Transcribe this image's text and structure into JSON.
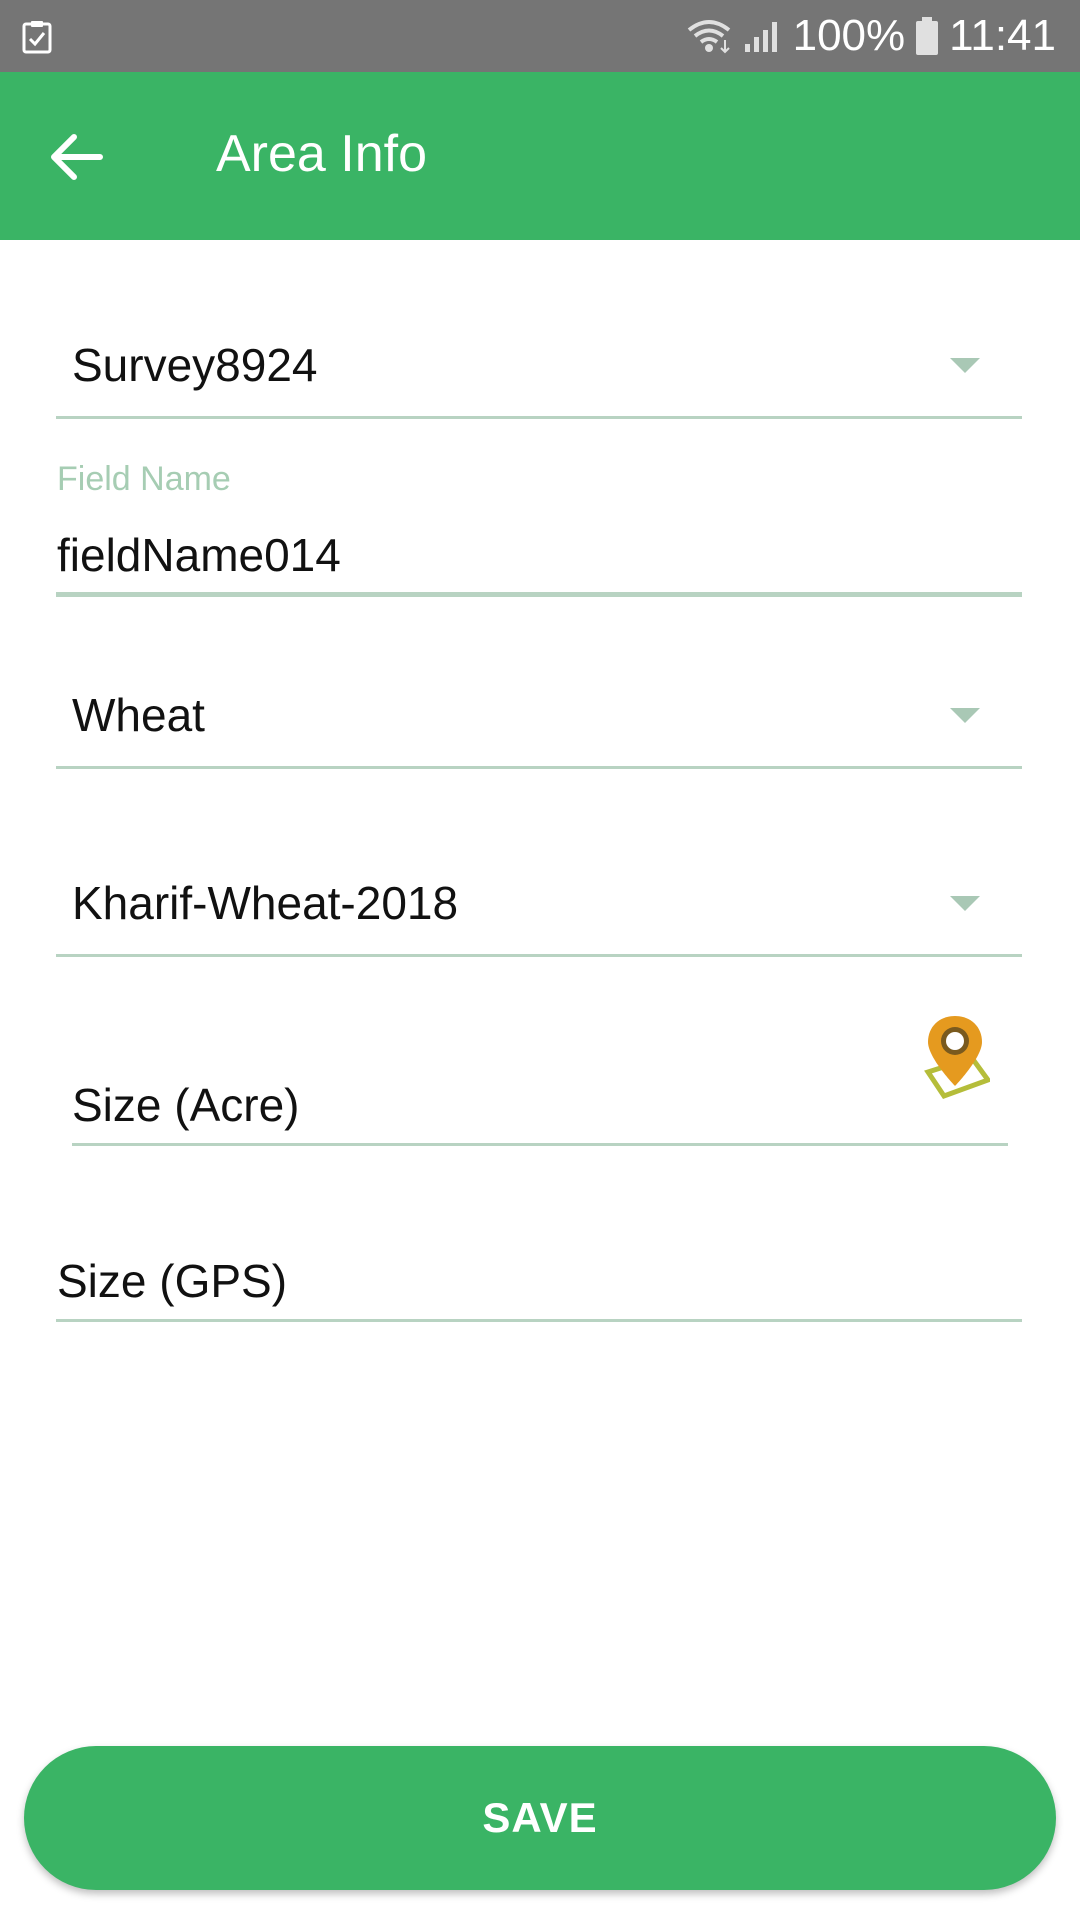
{
  "status_bar": {
    "left_icon": "clipboard-check-icon",
    "wifi_icon": "wifi-icon",
    "signal_icon": "signal-icon",
    "battery_text": "100%",
    "battery_icon": "battery-icon",
    "time": "11:41"
  },
  "app_bar": {
    "back_icon": "arrow-left-icon",
    "title": "Area Info",
    "background_color": "#3ab465"
  },
  "form": {
    "survey_select": {
      "value": "Survey8924",
      "icon": "chevron-down-icon"
    },
    "field_name": {
      "label": "Field Name",
      "value": "fieldName014"
    },
    "crop_select": {
      "value": "Wheat",
      "icon": "chevron-down-icon"
    },
    "season_select": {
      "value": "Kharif-Wheat-2018",
      "icon": "chevron-down-icon"
    },
    "size_acre": {
      "placeholder": "Size (Acre)",
      "icon": "map-pin-area-icon"
    },
    "size_gps": {
      "placeholder": "Size (GPS)"
    }
  },
  "actions": {
    "save_label": "SAVE"
  },
  "colors": {
    "accent": "#3ab465",
    "underline": "#b8d3c2",
    "pin": "#e59a1f",
    "status_bar": "#757575"
  }
}
